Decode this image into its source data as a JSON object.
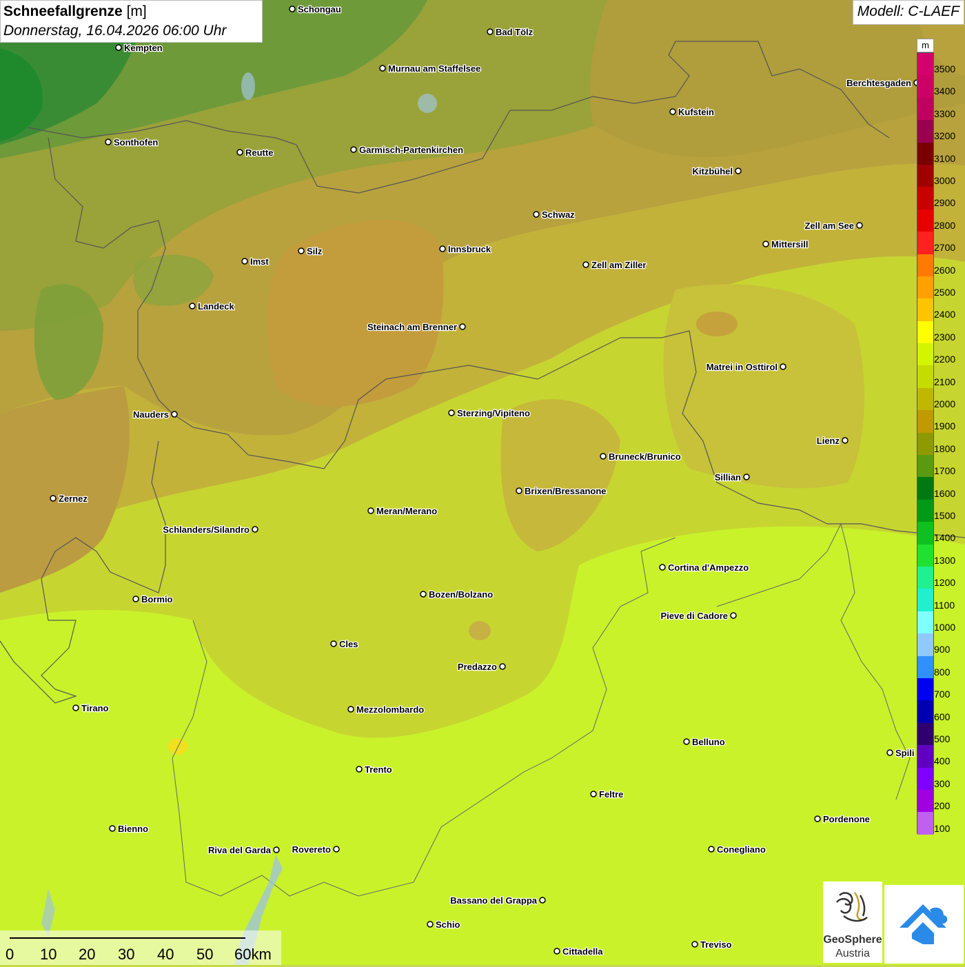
{
  "title": {
    "parameter": "Schneefallgrenze",
    "unit": "[m]",
    "datetime": "Donnerstag, 16.04.2026 06:00 Uhr"
  },
  "model": "Modell: C-LAEF",
  "legend": {
    "unit": "m",
    "levels": [
      {
        "value": "3500",
        "color": "#d4006e"
      },
      {
        "value": "3400",
        "color": "#cc0066"
      },
      {
        "value": "3300",
        "color": "#c00060"
      },
      {
        "value": "3200",
        "color": "#9a0050"
      },
      {
        "value": "3100",
        "color": "#7a0000"
      },
      {
        "value": "3000",
        "color": "#a00000"
      },
      {
        "value": "2900",
        "color": "#c80000"
      },
      {
        "value": "2800",
        "color": "#e80000"
      },
      {
        "value": "2700",
        "color": "#ff2020"
      },
      {
        "value": "2600",
        "color": "#ff7a00"
      },
      {
        "value": "2500",
        "color": "#ffa000"
      },
      {
        "value": "2400",
        "color": "#ffc400"
      },
      {
        "value": "2300",
        "color": "#ffff00"
      },
      {
        "value": "2200",
        "color": "#d4f500"
      },
      {
        "value": "2100",
        "color": "#c4dc00"
      },
      {
        "value": "2000",
        "color": "#c0b800"
      },
      {
        "value": "1900",
        "color": "#c09a00"
      },
      {
        "value": "1800",
        "color": "#8f9a00"
      },
      {
        "value": "1700",
        "color": "#5a9a10"
      },
      {
        "value": "1600",
        "color": "#007a10"
      },
      {
        "value": "1500",
        "color": "#009a18"
      },
      {
        "value": "1400",
        "color": "#10c020"
      },
      {
        "value": "1300",
        "color": "#20e030"
      },
      {
        "value": "1200",
        "color": "#20f090"
      },
      {
        "value": "1100",
        "color": "#20f0d0"
      },
      {
        "value": "1000",
        "color": "#80ffff"
      },
      {
        "value": "900",
        "color": "#90c8ff"
      },
      {
        "value": "800",
        "color": "#3090ff"
      },
      {
        "value": "700",
        "color": "#0000f0"
      },
      {
        "value": "600",
        "color": "#0000b0"
      },
      {
        "value": "500",
        "color": "#300070"
      },
      {
        "value": "400",
        "color": "#6000c0"
      },
      {
        "value": "300",
        "color": "#8000ff"
      },
      {
        "value": "200",
        "color": "#a000e0"
      },
      {
        "value": "100",
        "color": "#c060f0"
      }
    ]
  },
  "scale_bar": {
    "labels": [
      "0",
      "10",
      "20",
      "30",
      "40",
      "50",
      "60km"
    ]
  },
  "cities": [
    {
      "name": "Schongau"
    },
    {
      "name": "Bad Tölz"
    },
    {
      "name": "Kempten"
    },
    {
      "name": "Murnau am Staffelsee"
    },
    {
      "name": "Berchtesgaden"
    },
    {
      "name": "Kufstein"
    },
    {
      "name": "Sonthofen"
    },
    {
      "name": "Reutte"
    },
    {
      "name": "Garmisch-Partenkirchen"
    },
    {
      "name": "Kitzbühel"
    },
    {
      "name": "Schwaz"
    },
    {
      "name": "Zell am See"
    },
    {
      "name": "Innsbruck"
    },
    {
      "name": "Mittersill"
    },
    {
      "name": "Imst"
    },
    {
      "name": "Silz"
    },
    {
      "name": "Zell am Ziller"
    },
    {
      "name": "Landeck"
    },
    {
      "name": "Steinach am Brenner"
    },
    {
      "name": "Matrei in Osttirol"
    },
    {
      "name": "Nauders"
    },
    {
      "name": "Sterzing/Vipiteno"
    },
    {
      "name": "Lienz"
    },
    {
      "name": "Bruneck/Brunico"
    },
    {
      "name": "Sillian"
    },
    {
      "name": "Brixen/Bressanone"
    },
    {
      "name": "Zernez"
    },
    {
      "name": "Meran/Merano"
    },
    {
      "name": "Schlanders/Silandro"
    },
    {
      "name": "Cortina d'Ampezzo"
    },
    {
      "name": "Bozen/Bolzano"
    },
    {
      "name": "Bormio"
    },
    {
      "name": "Pieve di Cadore"
    },
    {
      "name": "Cles"
    },
    {
      "name": "Predazzo"
    },
    {
      "name": "Tirano"
    },
    {
      "name": "Mezzolombardo"
    },
    {
      "name": "Belluno"
    },
    {
      "name": "Spili"
    },
    {
      "name": "Trento"
    },
    {
      "name": "Feltre"
    },
    {
      "name": "Pordenone"
    },
    {
      "name": "Bienno"
    },
    {
      "name": "Riva del Garda"
    },
    {
      "name": "Rovereto"
    },
    {
      "name": "Conegliano"
    },
    {
      "name": "Bassano del Grappa"
    },
    {
      "name": "Schio"
    },
    {
      "name": "Treviso"
    },
    {
      "name": "Cittadella"
    }
  ],
  "logo": {
    "line1": "GeoSphere",
    "line2": "Austria"
  }
}
